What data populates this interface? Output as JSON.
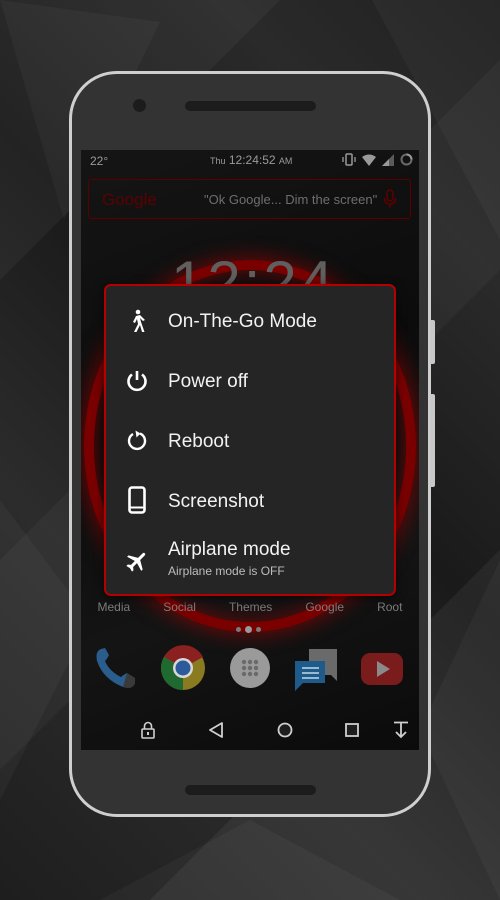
{
  "statusbar": {
    "temperature": "22°",
    "day": "Thu",
    "time": "12:24:52",
    "ampm": "AM",
    "icons": [
      "vibrate-icon",
      "wifi-icon",
      "signal-icon",
      "battery-circle-icon"
    ]
  },
  "search": {
    "logo": "Google",
    "hint": "\"Ok Google... Dim the screen\"",
    "mic_icon": "mic-icon"
  },
  "lockscreen": {
    "clock": "12:24"
  },
  "power_menu": {
    "items": [
      {
        "icon": "walking-person-icon",
        "label": "On-The-Go Mode"
      },
      {
        "icon": "power-icon",
        "label": "Power off"
      },
      {
        "icon": "reboot-icon",
        "label": "Reboot"
      },
      {
        "icon": "phone-screenshot-icon",
        "label": "Screenshot"
      },
      {
        "icon": "airplane-icon",
        "label": "Airplane mode",
        "sublabel": "Airplane mode is OFF"
      }
    ]
  },
  "home": {
    "folders": [
      "Media",
      "Social",
      "Themes",
      "Google",
      "Root"
    ],
    "page_count": 3,
    "active_page": 2,
    "dock": [
      {
        "icon": "phone-app-icon",
        "name": "Phone"
      },
      {
        "icon": "chrome-app-icon",
        "name": "Chrome"
      },
      {
        "icon": "app-drawer-icon",
        "name": "App drawer"
      },
      {
        "icon": "messenger-app-icon",
        "name": "Messenger"
      },
      {
        "icon": "youtube-app-icon",
        "name": "YouTube"
      }
    ]
  },
  "navbar": {
    "buttons": [
      "lock-icon",
      "back-icon",
      "home-icon",
      "recents-icon",
      "notification-pulldown-icon"
    ]
  },
  "colors": {
    "accent_red": "#b50000",
    "dialog_bg": "#252525",
    "dark_red": "#5c0000"
  }
}
